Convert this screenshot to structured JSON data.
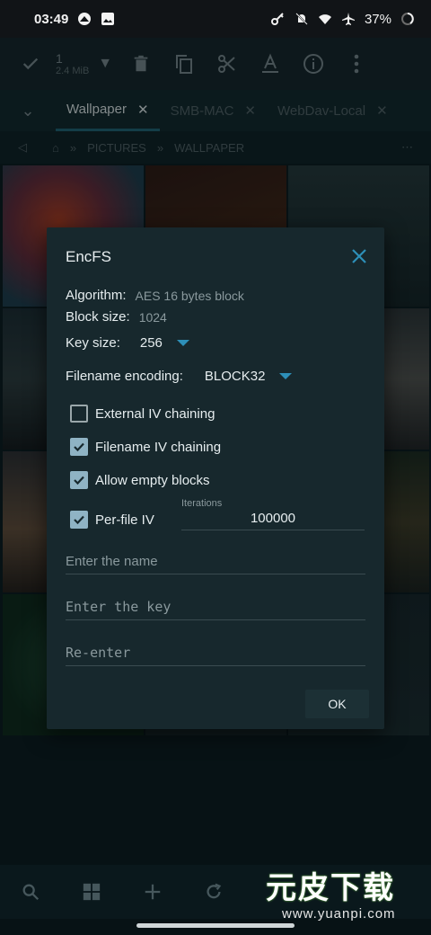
{
  "status_bar": {
    "time": "03:49",
    "battery": "37%",
    "icons": [
      "notification-icon",
      "image-icon",
      "key-icon",
      "bell-off-icon",
      "wifi-icon",
      "airplane-icon",
      "battery-icon"
    ]
  },
  "toolbar": {
    "selected_count": "1",
    "selected_size": "2.4 MiB",
    "icons": [
      "check-icon",
      "caret-down-icon",
      "delete-icon",
      "copy-icon",
      "cut-icon",
      "rename-icon",
      "info-icon",
      "more-vert-icon"
    ]
  },
  "tabs": [
    {
      "label": "Wallpaper",
      "active": true
    },
    {
      "label": "SMB-MAC",
      "active": false
    },
    {
      "label": "WebDav-Local",
      "active": false
    }
  ],
  "breadcrumb": {
    "items": [
      "PICTURES",
      "WALLPAPER"
    ],
    "separator": "»"
  },
  "dialog": {
    "title": "EncFS",
    "algorithm_label": "Algorithm:",
    "algorithm_value": "AES 16 bytes block",
    "block_size_label": "Block size:",
    "block_size_value": "1024",
    "key_size_label": "Key size:",
    "key_size_value": "256",
    "filename_encoding_label": "Filename encoding:",
    "filename_encoding_value": "BLOCK32",
    "options": [
      {
        "label": "External IV chaining",
        "checked": false
      },
      {
        "label": "Filename IV chaining",
        "checked": true
      },
      {
        "label": "Allow empty blocks",
        "checked": true
      },
      {
        "label": "Per-file IV",
        "checked": true
      }
    ],
    "iterations_label": "Iterations",
    "iterations_value": "100000",
    "name_placeholder": "Enter the name",
    "key_placeholder": "Enter the key",
    "reenter_placeholder": "Re-enter",
    "ok_label": "OK"
  },
  "bottom_bar": {
    "icons": [
      "search-icon",
      "grid-view-icon",
      "add-icon",
      "refresh-icon"
    ]
  },
  "watermark": {
    "title": "元皮下载",
    "url": "www.yuanpi.com"
  },
  "colors": {
    "accent": "#2d8fb8",
    "checkbox": "#8fb3c4",
    "dialog_bg": "#17282d"
  }
}
